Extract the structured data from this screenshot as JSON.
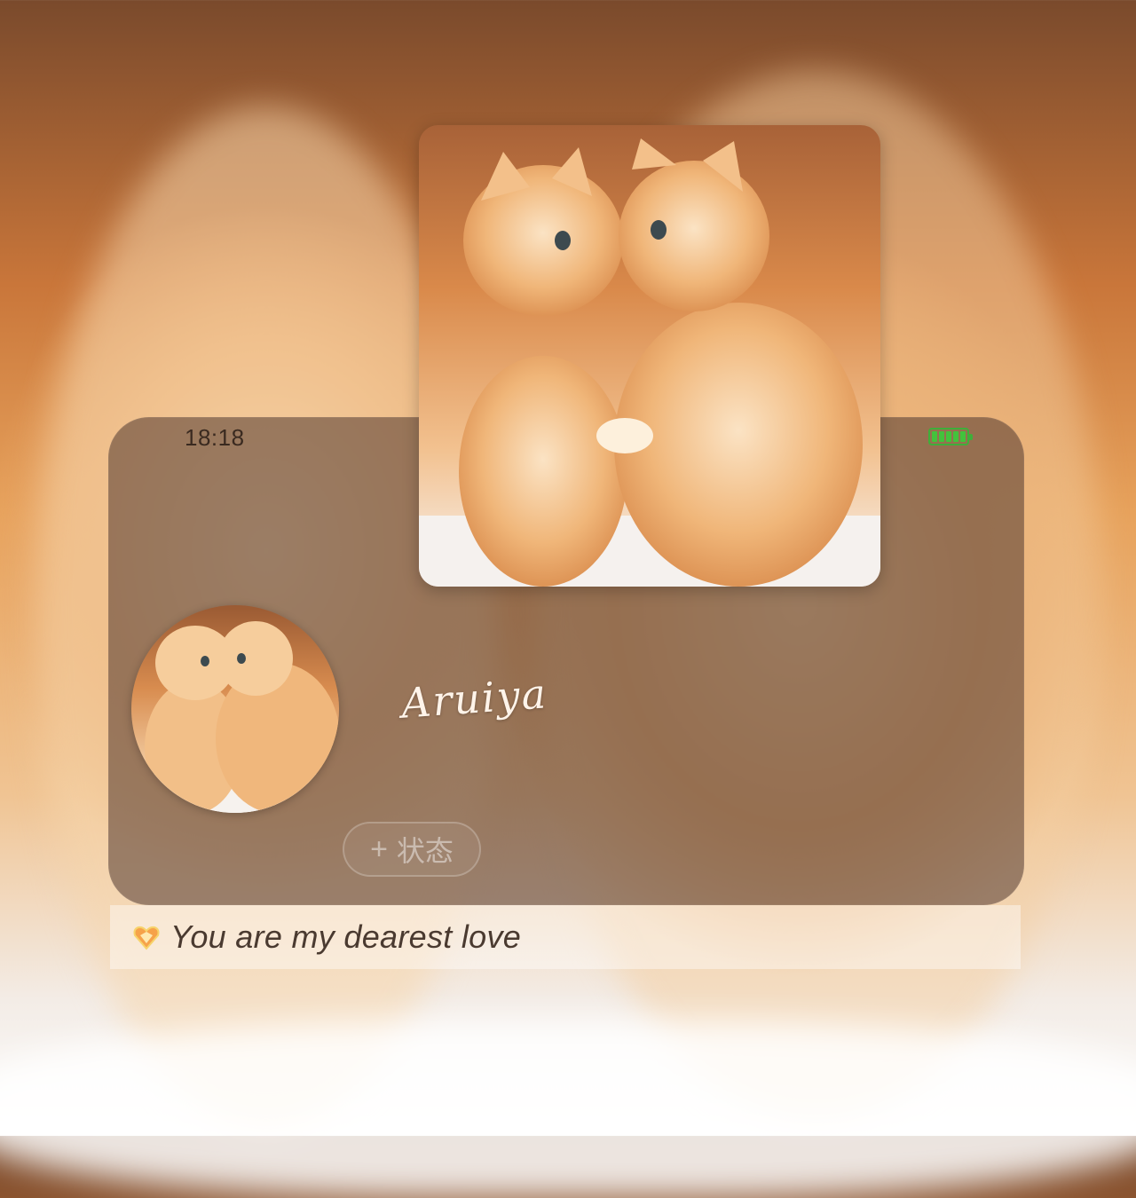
{
  "status_bar": {
    "time": "18:18",
    "battery_color": "#43c23c"
  },
  "profile": {
    "signature_name": "Aruiya",
    "status_button_label": "状态",
    "status_button_icon": "plus-icon",
    "bio": "You are my dearest love",
    "bio_icon": "heart-icon"
  },
  "images": {
    "cover_photo": "two kittens touching paws in sunset light",
    "avatar": "two kittens touching paws"
  },
  "colors": {
    "card_overlay": "#50372d",
    "accent_orange": "#e7a25c"
  }
}
